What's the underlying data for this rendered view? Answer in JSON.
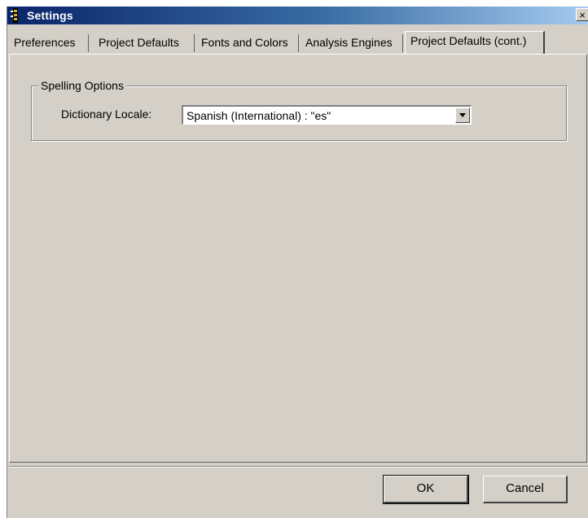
{
  "window": {
    "title": "Settings",
    "close_label": "×"
  },
  "tabs": [
    {
      "label": "Preferences",
      "active": false
    },
    {
      "label": "Project Defaults",
      "active": false
    },
    {
      "label": "Fonts and Colors",
      "active": false
    },
    {
      "label": "Analysis Engines",
      "active": false
    },
    {
      "label": "Project Defaults (cont.)",
      "active": true
    }
  ],
  "spelling_options": {
    "group_label": "Spelling Options",
    "dictionary_locale_label": "Dictionary Locale:",
    "dictionary_locale_value": "Spanish (International) : \"es\""
  },
  "buttons": {
    "ok_label": "OK",
    "cancel_label": "Cancel"
  },
  "icons": {
    "app": "settings-app-icon",
    "close": "close-icon",
    "dropdown": "chevron-down-icon"
  },
  "colors": {
    "title_bar": "#0a246a",
    "dialog_face": "#d4d0c8"
  }
}
